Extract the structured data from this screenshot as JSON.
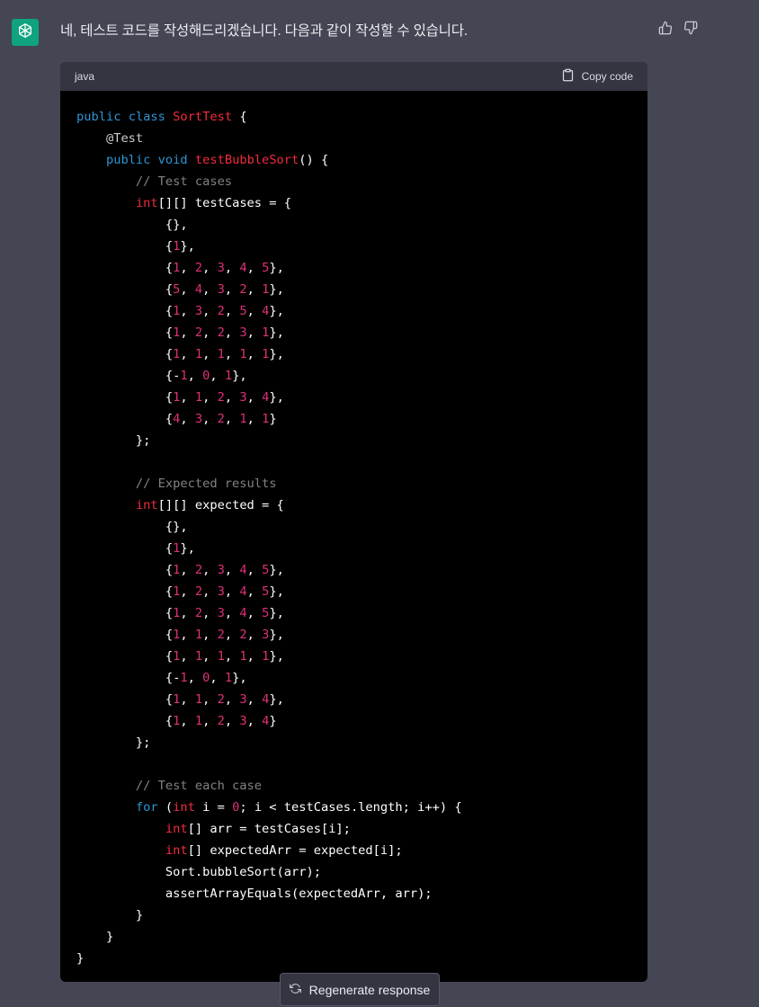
{
  "message": {
    "text": "네, 테스트 코드를 작성해드리겠습니다. 다음과 같이 작성할 수 있습니다."
  },
  "icons": {
    "avatar": "openai-logo-icon",
    "thumbs_up": "thumbs-up-icon",
    "thumbs_down": "thumbs-down-icon",
    "copy": "clipboard-icon",
    "regenerate": "refresh-icon"
  },
  "code_block": {
    "language": "java",
    "copy_label": "Copy code",
    "lines": [
      [
        [
          "kw",
          "public"
        ],
        [
          "p",
          " "
        ],
        [
          "kw",
          "class"
        ],
        [
          "p",
          " "
        ],
        [
          "name",
          "SortTest"
        ],
        [
          "p",
          " {"
        ]
      ],
      [
        [
          "ann",
          "    @Test"
        ]
      ],
      [
        [
          "p",
          "    "
        ],
        [
          "kw",
          "public"
        ],
        [
          "p",
          " "
        ],
        [
          "kw",
          "void"
        ],
        [
          "p",
          " "
        ],
        [
          "name",
          "testBubbleSort"
        ],
        [
          "p",
          "() {"
        ]
      ],
      [
        [
          "com",
          "        // Test cases"
        ]
      ],
      [
        [
          "p",
          "        "
        ],
        [
          "type",
          "int"
        ],
        [
          "p",
          "[][] testCases = {"
        ]
      ],
      [
        [
          "p",
          "            {},"
        ]
      ],
      [
        [
          "p",
          "            {"
        ],
        [
          "num",
          "1"
        ],
        [
          "p",
          "},"
        ]
      ],
      [
        [
          "p",
          "            {"
        ],
        [
          "num",
          "1"
        ],
        [
          "p",
          ", "
        ],
        [
          "num",
          "2"
        ],
        [
          "p",
          ", "
        ],
        [
          "num",
          "3"
        ],
        [
          "p",
          ", "
        ],
        [
          "num",
          "4"
        ],
        [
          "p",
          ", "
        ],
        [
          "num",
          "5"
        ],
        [
          "p",
          "},"
        ]
      ],
      [
        [
          "p",
          "            {"
        ],
        [
          "num",
          "5"
        ],
        [
          "p",
          ", "
        ],
        [
          "num",
          "4"
        ],
        [
          "p",
          ", "
        ],
        [
          "num",
          "3"
        ],
        [
          "p",
          ", "
        ],
        [
          "num",
          "2"
        ],
        [
          "p",
          ", "
        ],
        [
          "num",
          "1"
        ],
        [
          "p",
          "},"
        ]
      ],
      [
        [
          "p",
          "            {"
        ],
        [
          "num",
          "1"
        ],
        [
          "p",
          ", "
        ],
        [
          "num",
          "3"
        ],
        [
          "p",
          ", "
        ],
        [
          "num",
          "2"
        ],
        [
          "p",
          ", "
        ],
        [
          "num",
          "5"
        ],
        [
          "p",
          ", "
        ],
        [
          "num",
          "4"
        ],
        [
          "p",
          "},"
        ]
      ],
      [
        [
          "p",
          "            {"
        ],
        [
          "num",
          "1"
        ],
        [
          "p",
          ", "
        ],
        [
          "num",
          "2"
        ],
        [
          "p",
          ", "
        ],
        [
          "num",
          "2"
        ],
        [
          "p",
          ", "
        ],
        [
          "num",
          "3"
        ],
        [
          "p",
          ", "
        ],
        [
          "num",
          "1"
        ],
        [
          "p",
          "},"
        ]
      ],
      [
        [
          "p",
          "            {"
        ],
        [
          "num",
          "1"
        ],
        [
          "p",
          ", "
        ],
        [
          "num",
          "1"
        ],
        [
          "p",
          ", "
        ],
        [
          "num",
          "1"
        ],
        [
          "p",
          ", "
        ],
        [
          "num",
          "1"
        ],
        [
          "p",
          ", "
        ],
        [
          "num",
          "1"
        ],
        [
          "p",
          "},"
        ]
      ],
      [
        [
          "p",
          "            {-"
        ],
        [
          "num",
          "1"
        ],
        [
          "p",
          ", "
        ],
        [
          "num",
          "0"
        ],
        [
          "p",
          ", "
        ],
        [
          "num",
          "1"
        ],
        [
          "p",
          "},"
        ]
      ],
      [
        [
          "p",
          "            {"
        ],
        [
          "num",
          "1"
        ],
        [
          "p",
          ", "
        ],
        [
          "num",
          "1"
        ],
        [
          "p",
          ", "
        ],
        [
          "num",
          "2"
        ],
        [
          "p",
          ", "
        ],
        [
          "num",
          "3"
        ],
        [
          "p",
          ", "
        ],
        [
          "num",
          "4"
        ],
        [
          "p",
          "},"
        ]
      ],
      [
        [
          "p",
          "            {"
        ],
        [
          "num",
          "4"
        ],
        [
          "p",
          ", "
        ],
        [
          "num",
          "3"
        ],
        [
          "p",
          ", "
        ],
        [
          "num",
          "2"
        ],
        [
          "p",
          ", "
        ],
        [
          "num",
          "1"
        ],
        [
          "p",
          ", "
        ],
        [
          "num",
          "1"
        ],
        [
          "p",
          "}"
        ]
      ],
      [
        [
          "p",
          "        };"
        ]
      ],
      [
        [
          "p",
          ""
        ]
      ],
      [
        [
          "com",
          "        // Expected results"
        ]
      ],
      [
        [
          "p",
          "        "
        ],
        [
          "type",
          "int"
        ],
        [
          "p",
          "[][] expected = {"
        ]
      ],
      [
        [
          "p",
          "            {},"
        ]
      ],
      [
        [
          "p",
          "            {"
        ],
        [
          "num",
          "1"
        ],
        [
          "p",
          "},"
        ]
      ],
      [
        [
          "p",
          "            {"
        ],
        [
          "num",
          "1"
        ],
        [
          "p",
          ", "
        ],
        [
          "num",
          "2"
        ],
        [
          "p",
          ", "
        ],
        [
          "num",
          "3"
        ],
        [
          "p",
          ", "
        ],
        [
          "num",
          "4"
        ],
        [
          "p",
          ", "
        ],
        [
          "num",
          "5"
        ],
        [
          "p",
          "},"
        ]
      ],
      [
        [
          "p",
          "            {"
        ],
        [
          "num",
          "1"
        ],
        [
          "p",
          ", "
        ],
        [
          "num",
          "2"
        ],
        [
          "p",
          ", "
        ],
        [
          "num",
          "3"
        ],
        [
          "p",
          ", "
        ],
        [
          "num",
          "4"
        ],
        [
          "p",
          ", "
        ],
        [
          "num",
          "5"
        ],
        [
          "p",
          "},"
        ]
      ],
      [
        [
          "p",
          "            {"
        ],
        [
          "num",
          "1"
        ],
        [
          "p",
          ", "
        ],
        [
          "num",
          "2"
        ],
        [
          "p",
          ", "
        ],
        [
          "num",
          "3"
        ],
        [
          "p",
          ", "
        ],
        [
          "num",
          "4"
        ],
        [
          "p",
          ", "
        ],
        [
          "num",
          "5"
        ],
        [
          "p",
          "},"
        ]
      ],
      [
        [
          "p",
          "            {"
        ],
        [
          "num",
          "1"
        ],
        [
          "p",
          ", "
        ],
        [
          "num",
          "1"
        ],
        [
          "p",
          ", "
        ],
        [
          "num",
          "2"
        ],
        [
          "p",
          ", "
        ],
        [
          "num",
          "2"
        ],
        [
          "p",
          ", "
        ],
        [
          "num",
          "3"
        ],
        [
          "p",
          "},"
        ]
      ],
      [
        [
          "p",
          "            {"
        ],
        [
          "num",
          "1"
        ],
        [
          "p",
          ", "
        ],
        [
          "num",
          "1"
        ],
        [
          "p",
          ", "
        ],
        [
          "num",
          "1"
        ],
        [
          "p",
          ", "
        ],
        [
          "num",
          "1"
        ],
        [
          "p",
          ", "
        ],
        [
          "num",
          "1"
        ],
        [
          "p",
          "},"
        ]
      ],
      [
        [
          "p",
          "            {-"
        ],
        [
          "num",
          "1"
        ],
        [
          "p",
          ", "
        ],
        [
          "num",
          "0"
        ],
        [
          "p",
          ", "
        ],
        [
          "num",
          "1"
        ],
        [
          "p",
          "},"
        ]
      ],
      [
        [
          "p",
          "            {"
        ],
        [
          "num",
          "1"
        ],
        [
          "p",
          ", "
        ],
        [
          "num",
          "1"
        ],
        [
          "p",
          ", "
        ],
        [
          "num",
          "2"
        ],
        [
          "p",
          ", "
        ],
        [
          "num",
          "3"
        ],
        [
          "p",
          ", "
        ],
        [
          "num",
          "4"
        ],
        [
          "p",
          "},"
        ]
      ],
      [
        [
          "p",
          "            {"
        ],
        [
          "num",
          "1"
        ],
        [
          "p",
          ", "
        ],
        [
          "num",
          "1"
        ],
        [
          "p",
          ", "
        ],
        [
          "num",
          "2"
        ],
        [
          "p",
          ", "
        ],
        [
          "num",
          "3"
        ],
        [
          "p",
          ", "
        ],
        [
          "num",
          "4"
        ],
        [
          "p",
          "}"
        ]
      ],
      [
        [
          "p",
          "        };"
        ]
      ],
      [
        [
          "p",
          ""
        ]
      ],
      [
        [
          "com",
          "        // Test each case"
        ]
      ],
      [
        [
          "p",
          "        "
        ],
        [
          "kw",
          "for"
        ],
        [
          "p",
          " ("
        ],
        [
          "type",
          "int"
        ],
        [
          "p",
          " i = "
        ],
        [
          "num",
          "0"
        ],
        [
          "p",
          "; i < testCases.length; i++) {"
        ]
      ],
      [
        [
          "p",
          "            "
        ],
        [
          "type",
          "int"
        ],
        [
          "p",
          "[] arr = testCases[i];"
        ]
      ],
      [
        [
          "p",
          "            "
        ],
        [
          "type",
          "int"
        ],
        [
          "p",
          "[] expectedArr = expected[i];"
        ]
      ],
      [
        [
          "p",
          "            Sort.bubbleSort(arr);"
        ]
      ],
      [
        [
          "p",
          "            assertArrayEquals(expectedArr, arr);"
        ]
      ],
      [
        [
          "p",
          "        }"
        ]
      ],
      [
        [
          "p",
          "    }"
        ]
      ],
      [
        [
          "p",
          "}"
        ]
      ]
    ]
  },
  "regenerate": {
    "label": "Regenerate response"
  },
  "colors": {
    "background": "#444654",
    "code_background": "#000000",
    "code_header": "#343541",
    "avatar": "#10a37f",
    "keyword": "#2e95d3",
    "name": "#f22c3d",
    "number": "#df3079"
  }
}
